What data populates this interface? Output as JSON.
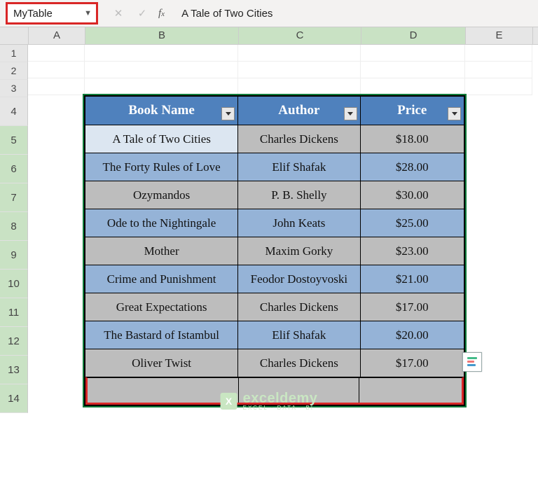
{
  "formula_bar": {
    "namebox": "MyTable",
    "formula_text": "A Tale of Two Cities"
  },
  "columns": [
    "A",
    "B",
    "C",
    "D",
    "E"
  ],
  "row_nums": [
    "1",
    "2",
    "3",
    "4",
    "5",
    "6",
    "7",
    "8",
    "9",
    "10",
    "11",
    "12",
    "13",
    "14"
  ],
  "table": {
    "headers": [
      "Book Name",
      "Author",
      "Price"
    ],
    "rows": [
      {
        "book": "A Tale of Two Cities",
        "author": "Charles Dickens",
        "price": "$18.00"
      },
      {
        "book": "The Forty Rules of Love",
        "author": "Elif Shafak",
        "price": "$28.00"
      },
      {
        "book": "Ozymandos",
        "author": "P. B. Shelly",
        "price": "$30.00"
      },
      {
        "book": "Ode to the Nightingale",
        "author": "John Keats",
        "price": "$25.00"
      },
      {
        "book": "Mother",
        "author": "Maxim Gorky",
        "price": "$23.00"
      },
      {
        "book": "Crime and Punishment",
        "author": "Feodor Dostoyvoski",
        "price": "$21.00"
      },
      {
        "book": "Great Expectations",
        "author": "Charles Dickens",
        "price": "$17.00"
      },
      {
        "book": "The Bastard of Istambul",
        "author": "Elif Shafak",
        "price": "$20.00"
      },
      {
        "book": "Oliver Twist",
        "author": "Charles Dickens",
        "price": "$17.00"
      }
    ]
  },
  "logo": {
    "icon": "X",
    "title": "exceldemy",
    "subtitle": "EXCEL · DATA · BI"
  }
}
